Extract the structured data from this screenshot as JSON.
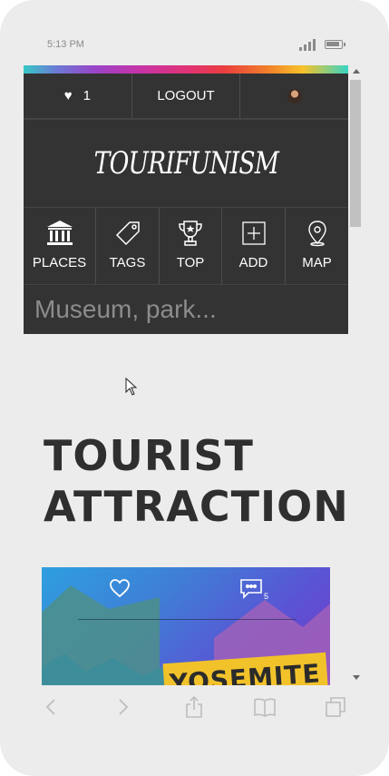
{
  "status_bar": {
    "time": "5:13 PM"
  },
  "header": {
    "favorites_count": "1",
    "logout_label": "LOGOUT",
    "logo_text": "TOURIFUNISM"
  },
  "nav": {
    "items": [
      {
        "label": "PLACES",
        "icon": "museum-icon"
      },
      {
        "label": "TAGS",
        "icon": "tag-icon"
      },
      {
        "label": "TOP",
        "icon": "trophy-icon"
      },
      {
        "label": "ADD",
        "icon": "plus-square-icon"
      },
      {
        "label": "MAP",
        "icon": "map-pin-icon"
      }
    ]
  },
  "search": {
    "placeholder": "Museum, park..."
  },
  "main": {
    "title_line1": "TOURIST",
    "title_line2": "ATTRACTIONS",
    "card": {
      "comment_count": "5",
      "banner_text": "YOSEMITE"
    }
  },
  "colors": {
    "header_bg": "#333333",
    "page_bg": "#ececec"
  }
}
